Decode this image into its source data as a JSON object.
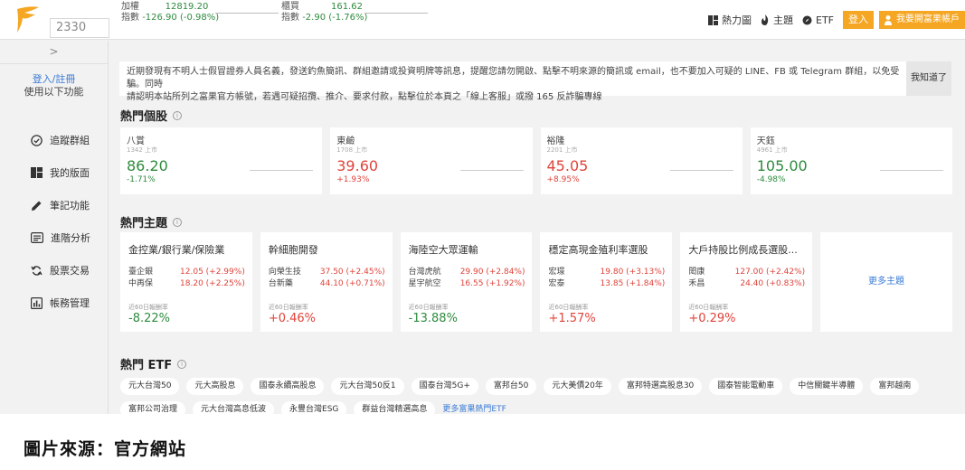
{
  "search": {
    "value": "2330"
  },
  "indices": [
    {
      "name1": "加權",
      "name2": "指數",
      "value": "12819.20",
      "change": "-126.90 (-0.98%)"
    },
    {
      "name1": "櫃買",
      "name2": "指數",
      "value": "161.62",
      "change": "-2.90 (-1.76%)"
    }
  ],
  "top_nav": {
    "heatmap": "熱力圖",
    "theme": "主題",
    "etf": "ETF",
    "login": "登入",
    "open_account": "我要開富果帳戶"
  },
  "sidebar": {
    "toggle": ">",
    "login_link": "登入/註冊",
    "login_sub": "使用以下功能",
    "items": [
      {
        "label": "追蹤群組",
        "icon": "check-circle-icon"
      },
      {
        "label": "我的版面",
        "icon": "dashboard-icon"
      },
      {
        "label": "筆記功能",
        "icon": "pencil-icon"
      },
      {
        "label": "進階分析",
        "icon": "list-icon"
      },
      {
        "label": "股票交易",
        "icon": "exchange-icon"
      },
      {
        "label": "帳務管理",
        "icon": "bar-chart-icon"
      }
    ]
  },
  "notice": {
    "line1": "近期發現有不明人士假冒證券人員名義，發送釣魚簡訊、群組邀請或投資明牌等訊息，提醒您請勿開啟、點擊不明來源的簡訊或 email，也不要加入可疑的 LINE、FB 或 Telegram 群組，以免受騙。同時",
    "line2": "請認明本站所列之富果官方帳號，若遇可疑招攬、推介、要求付款，點擊位於本頁之「線上客服」或撥 165 反詐騙專線",
    "dismiss": "我知道了"
  },
  "hot_stocks": {
    "title": "熱門個股",
    "items": [
      {
        "name": "八賞",
        "code": "1342 上市",
        "price": "86.20",
        "change": "-1.71%",
        "dir": "down"
      },
      {
        "name": "東鹼",
        "code": "1708 上市",
        "price": "39.60",
        "change": "+1.93%",
        "dir": "up"
      },
      {
        "name": "裕隆",
        "code": "2201 上市",
        "price": "45.05",
        "change": "+8.95%",
        "dir": "up"
      },
      {
        "name": "天鈺",
        "code": "4961 上市",
        "price": "105.00",
        "change": "-4.98%",
        "dir": "down"
      }
    ]
  },
  "hot_themes": {
    "title": "熱門主題",
    "return_label": "近60日報酬率",
    "more": "更多主題",
    "items": [
      {
        "title": "金控業/銀行業/保險業",
        "stocks": [
          {
            "name": "臺企銀",
            "val": "12.05 (+2.99%)"
          },
          {
            "name": "中再保",
            "val": "18.20 (+2.25%)"
          }
        ],
        "ret": "-8.22%",
        "dir": "down"
      },
      {
        "title": "幹細胞開發",
        "stocks": [
          {
            "name": "向榮生技",
            "val": "37.50 (+2.45%)"
          },
          {
            "name": "台新藥",
            "val": "44.10 (+0.71%)"
          }
        ],
        "ret": "+0.46%",
        "dir": "up"
      },
      {
        "title": "海陸空大眾運輸",
        "stocks": [
          {
            "name": "台灣虎航",
            "val": "29.90 (+2.84%)"
          },
          {
            "name": "星宇航空",
            "val": "16.55 (+1.92%)"
          }
        ],
        "ret": "-13.88%",
        "dir": "down"
      },
      {
        "title": "穩定高現金殖利率選股",
        "stocks": [
          {
            "name": "宏璟",
            "val": "19.80 (+3.13%)"
          },
          {
            "name": "宏泰",
            "val": "13.85 (+1.84%)"
          }
        ],
        "ret": "+1.57%",
        "dir": "up"
      },
      {
        "title": "大戶持股比例成長選股...",
        "stocks": [
          {
            "name": "閎康",
            "val": "127.00 (+2.42%)"
          },
          {
            "name": "禾昌",
            "val": "24.40 (+0.83%)"
          }
        ],
        "ret": "+0.29%",
        "dir": "up"
      }
    ]
  },
  "hot_etf": {
    "title": "熱門 ETF",
    "row1": [
      "元大台灣50",
      "元大高股息",
      "國泰永續高股息",
      "元大台灣50反1",
      "國泰台灣5G+",
      "富邦台50",
      "元大美債20年",
      "富邦特選高股息30",
      "國泰智能電動車",
      "中信關鍵半導體",
      "富邦越南"
    ],
    "row2": [
      "富邦公司治理",
      "元大台灣高息低波",
      "永豐台灣ESG",
      "群益台灣精選高息"
    ],
    "more": "更多富果熱門ETF"
  },
  "caption": "圖片來源：官方網站",
  "colors": {
    "accent": "#f5a623",
    "up": "#e0443b",
    "down": "#2e8b3e",
    "link": "#3a7bd5"
  }
}
